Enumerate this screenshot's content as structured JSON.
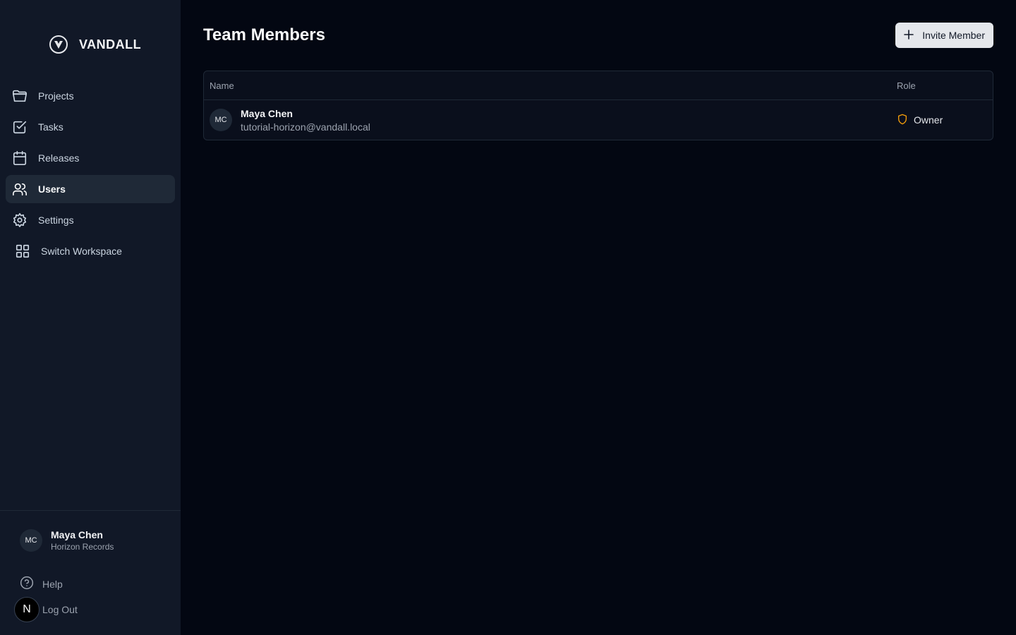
{
  "brand": {
    "name": "VANDALL"
  },
  "sidebar": {
    "items": [
      {
        "label": "Projects",
        "icon": "folder-icon"
      },
      {
        "label": "Tasks",
        "icon": "checkbox-icon"
      },
      {
        "label": "Releases",
        "icon": "calendar-icon"
      },
      {
        "label": "Users",
        "icon": "users-icon",
        "active": true
      },
      {
        "label": "Settings",
        "icon": "gear-icon"
      },
      {
        "label": "Switch Workspace",
        "icon": "grid-icon"
      }
    ]
  },
  "profile": {
    "initials": "MC",
    "name": "Maya Chen",
    "org": "Horizon Records"
  },
  "footer": {
    "help": "Help",
    "logout": "Log Out",
    "badge": "N"
  },
  "main": {
    "title": "Team Members",
    "invite_label": "Invite Member",
    "table": {
      "headers": {
        "name": "Name",
        "role": "Role"
      },
      "rows": [
        {
          "initials": "MC",
          "name": "Maya Chen",
          "email": "tutorial-horizon@vandall.local",
          "role": "Owner"
        }
      ]
    }
  },
  "colors": {
    "background": "#030712",
    "sidebar": "#111827",
    "role_icon": "#f59e0b"
  }
}
